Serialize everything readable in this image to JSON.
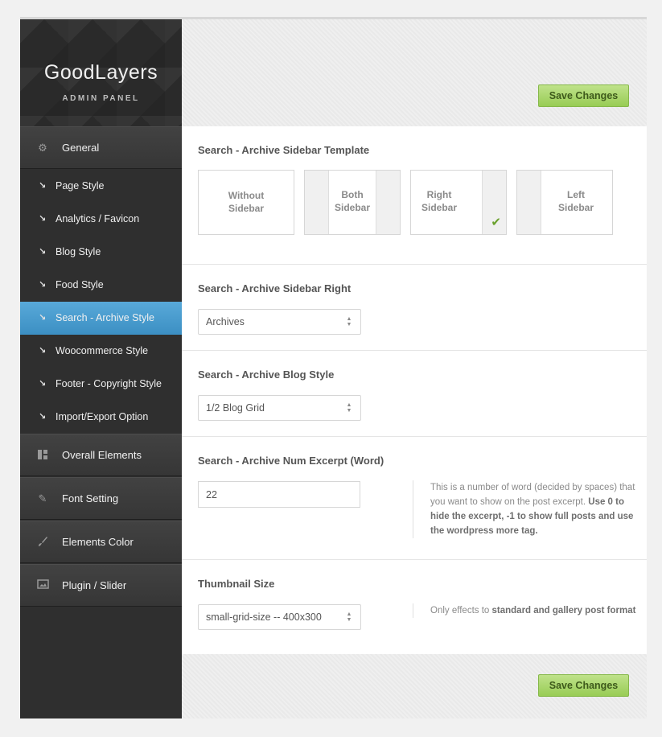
{
  "brand": {
    "title": "GoodLayers",
    "subtitle": "ADMIN PANEL"
  },
  "sidebar": {
    "sections": [
      {
        "label": "General",
        "icon": "gear-icon"
      },
      {
        "label": "Overall Elements",
        "icon": "layout-icon"
      },
      {
        "label": "Font Setting",
        "icon": "pencil-icon"
      },
      {
        "label": "Elements Color",
        "icon": "brush-icon"
      },
      {
        "label": "Plugin / Slider",
        "icon": "image-icon"
      }
    ],
    "items": [
      {
        "label": "Page Style"
      },
      {
        "label": "Analytics / Favicon"
      },
      {
        "label": "Blog Style"
      },
      {
        "label": "Food Style"
      },
      {
        "label": "Search - Archive Style",
        "active": true
      },
      {
        "label": "Woocommerce Style"
      },
      {
        "label": "Footer - Copyright Style"
      },
      {
        "label": "Import/Export Option"
      }
    ]
  },
  "toolbar": {
    "save_label": "Save Changes"
  },
  "options": {
    "template": {
      "title": "Search - Archive Sidebar Template",
      "choices": [
        {
          "line1": "Without",
          "line2": "Sidebar"
        },
        {
          "line1": "Both",
          "line2": "Sidebar"
        },
        {
          "line1": "Right",
          "line2": "Sidebar",
          "selected": true
        },
        {
          "line1": "Left",
          "line2": "Sidebar"
        }
      ]
    },
    "sidebar_right": {
      "title": "Search - Archive Sidebar Right",
      "value": "Archives"
    },
    "blog_style": {
      "title": "Search - Archive Blog Style",
      "value": "1/2 Blog Grid"
    },
    "num_excerpt": {
      "title": "Search - Archive Num Excerpt (Word)",
      "value": "22",
      "desc_plain": "This is a number of word (decided by spaces) that you want to show on the post excerpt.",
      "desc_bold": "Use 0 to hide the excerpt, -1 to show full posts and use the wordpress more tag."
    },
    "thumbnail": {
      "title": "Thumbnail Size",
      "value": "small-grid-size -- 400x300",
      "desc_plain": "Only effects to",
      "desc_bold": "standard and gallery post format"
    }
  },
  "colors": {
    "sidebar_bg": "#2f2f2f",
    "active_item": "#4a9fd2",
    "save_button": "#a8d46a",
    "check_mark": "#6aa12d"
  }
}
